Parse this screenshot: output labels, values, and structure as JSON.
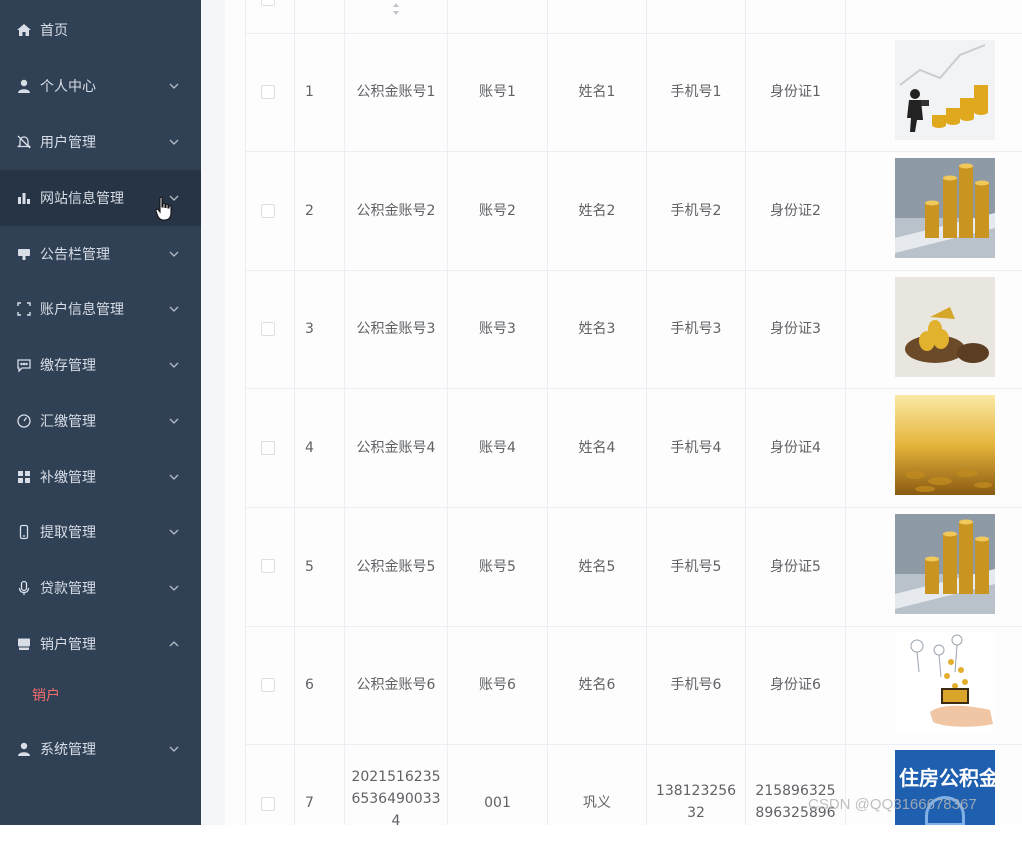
{
  "sidebar": {
    "items": [
      {
        "label": "首页",
        "icon": "home-icon",
        "has_arrow": false
      },
      {
        "label": "个人中心",
        "icon": "user-icon",
        "has_arrow": true
      },
      {
        "label": "用户管理",
        "icon": "bell-off-icon",
        "has_arrow": true
      },
      {
        "label": "网站信息管理",
        "icon": "bar-chart-icon",
        "has_arrow": true
      },
      {
        "label": "公告栏管理",
        "icon": "notice-icon",
        "has_arrow": true
      },
      {
        "label": "账户信息管理",
        "icon": "crop-icon",
        "has_arrow": true
      },
      {
        "label": "缴存管理",
        "icon": "chat-icon",
        "has_arrow": true
      },
      {
        "label": "汇缴管理",
        "icon": "gauge-icon",
        "has_arrow": true
      },
      {
        "label": "补缴管理",
        "icon": "grid-icon",
        "has_arrow": true
      },
      {
        "label": "提取管理",
        "icon": "phone-icon",
        "has_arrow": true
      },
      {
        "label": "贷款管理",
        "icon": "mic-icon",
        "has_arrow": true
      },
      {
        "label": "销户管理",
        "icon": "monitor-icon",
        "has_arrow": true,
        "expanded": true
      },
      {
        "label": "系统管理",
        "icon": "user-icon",
        "has_arrow": true
      }
    ],
    "sub_item": "销户"
  },
  "table": {
    "rows": [
      {
        "index": "1",
        "fund_account": "公积金账号1",
        "account": "账号1",
        "name": "姓名1",
        "phone": "手机号1",
        "id_card": "身份证1",
        "image": "businessman-coins"
      },
      {
        "index": "2",
        "fund_account": "公积金账号2",
        "account": "账号2",
        "name": "姓名2",
        "phone": "手机号2",
        "id_card": "身份证2",
        "image": "coin-stacks"
      },
      {
        "index": "3",
        "fund_account": "公积金账号3",
        "account": "账号3",
        "name": "姓名3",
        "phone": "手机号3",
        "id_card": "身份证3",
        "image": "gold-nest"
      },
      {
        "index": "4",
        "fund_account": "公积金账号4",
        "account": "账号4",
        "name": "姓名4",
        "phone": "手机号4",
        "id_card": "身份证4",
        "image": "gold-coins-pile"
      },
      {
        "index": "5",
        "fund_account": "公积金账号5",
        "account": "账号5",
        "name": "姓名5",
        "phone": "手机号5",
        "id_card": "身份证5",
        "image": "coin-stacks"
      },
      {
        "index": "6",
        "fund_account": "公积金账号6",
        "account": "账号6",
        "name": "姓名6",
        "phone": "手机号6",
        "id_card": "身份证6",
        "image": "hand-coins"
      },
      {
        "index": "7",
        "fund_account": "20215162356536490033 4",
        "account": "001",
        "name": "巩义",
        "phone": "138123256 32",
        "id_card": "215896325 896325896",
        "image": "housing-fund-logo",
        "image_text": "住房公积金"
      }
    ]
  },
  "watermark": "CSDN @QQ3166678367",
  "colors": {
    "sidebar_bg": "#304156",
    "sidebar_text": "#d8dde6",
    "active_sub": "#f56c6c",
    "cell_text": "#606266",
    "border": "#ebeef5"
  }
}
